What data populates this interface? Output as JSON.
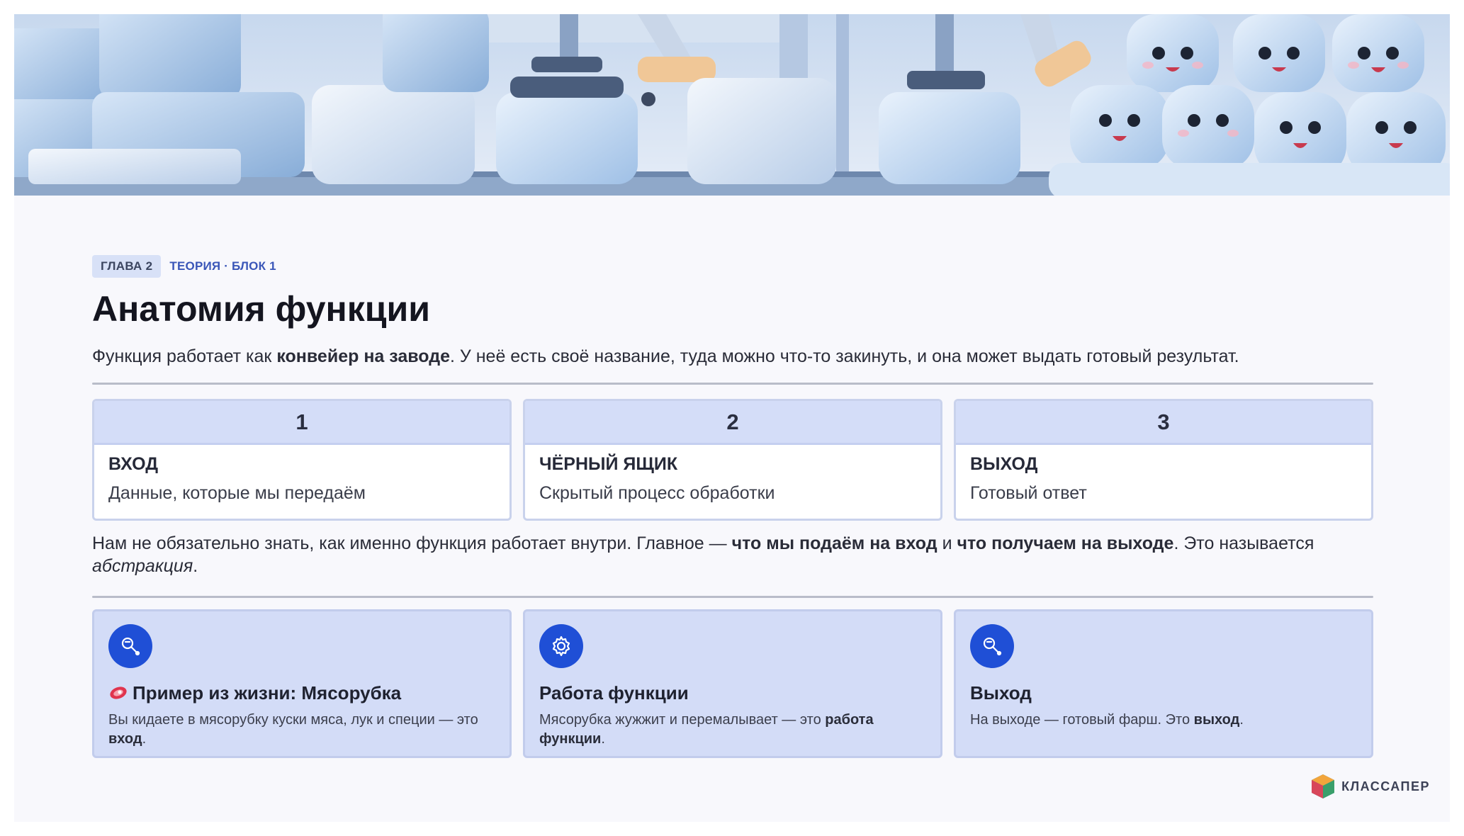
{
  "header": {
    "chip": "ГЛАВА 2",
    "section": "ТЕОРИЯ · БЛОК 1",
    "title": "Анатомия функции"
  },
  "lead": {
    "p1": "Функция работает как ",
    "bold": "конвейер на заводе",
    "p2": ". У неё есть своё название, туда можно что-то закинуть, и она может выдать готовый результат."
  },
  "steps": [
    {
      "number": "1",
      "title": "ВХОД",
      "desc": "Данные, которые мы передаём"
    },
    {
      "number": "2",
      "title": "ЧЁРНЫЙ ЯЩИК",
      "desc": "Скрытый процесс обработки"
    },
    {
      "number": "3",
      "title": "ВЫХОД",
      "desc": "Готовый ответ"
    }
  ],
  "note": {
    "p1": "Нам не обязательно знать, как именно функция работает внутри. Главное — ",
    "b1": "что мы подаём на вход",
    "p2": " и ",
    "b2": "что получаем на выходе",
    "p3": ". Это называется ",
    "i1": "абстракция",
    "p4": "."
  },
  "cards": [
    {
      "icon": "meat-grinder-icon",
      "title": "Пример из жизни: Мясорубка",
      "desc1": "Вы кидаете в мясорубку куски мяса, лук и специи — это ",
      "bold": "вход",
      "desc2": "."
    },
    {
      "icon": "gear-icon",
      "title": "Работа функции",
      "desc1": "Мясорубка жужжит и перемалывает — это ",
      "bold": "работа функции",
      "desc2": "."
    },
    {
      "icon": "meat-grinder-icon",
      "title": "Выход",
      "desc1": "На выходе — готовый фарш. Это ",
      "bold": "выход",
      "desc2": "."
    }
  ],
  "brand": {
    "name": "КЛАССАПЕР"
  },
  "colors": {
    "accent": "#1f4fd6",
    "card_bg": "#d3dcf7",
    "step_head": "#d4ddf8"
  }
}
